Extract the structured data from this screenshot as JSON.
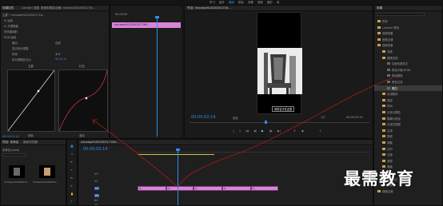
{
  "menubar": {
    "left_tabs": [
      "效果控件",
      "Lumetri 范围",
      "音频剪辑混合器: minzepl2020031716...",
      "minzepl2020031716..."
    ],
    "right_items": [
      "学习",
      "组件",
      "编辑",
      "颜色",
      "效果",
      "音频",
      "图形",
      "库"
    ]
  },
  "effect_controls": {
    "source": "主要 * minzepa%2020031716...",
    "clip_label": "minzepa%20200317160...",
    "timecode_start": "00:00:00",
    "rows": [
      {
        "label": "fx 运动"
      },
      {
        "label": "fx 不透明度"
      },
      {
        "label": "时间重映射"
      },
      {
        "label": "RGB 曲线"
      },
      {
        "label": "输出",
        "value": "合成"
      },
      {
        "label": "显示拆分视图"
      },
      {
        "label": "布局",
        "value": "水平"
      },
      {
        "label": "拆分视图百分比",
        "value": "50.00 %"
      }
    ],
    "curve_labels": {
      "master": "主要",
      "red": "红色",
      "green": "绿色",
      "blue": "蓝色"
    },
    "footer_time": "00:00:02:14",
    "colors": {
      "master_curve": "#e0e0e0",
      "red_curve": "#c23838",
      "clip_pink": "#d884d8"
    }
  },
  "program_monitor": {
    "title": "节目: minzepa%2020031716...",
    "timecode": "00:00:02:14",
    "fit_label": "适合",
    "ratio": "1/2",
    "duration": "00:00:03:20",
    "caption": "你的名字在这里"
  },
  "project_panel": {
    "title": "项目: 未命名",
    "tab2": "媒体浏览器",
    "file": "未命名.prproj",
    "items": [
      {
        "name": "minzepa%2020031...",
        "duration": "5:00"
      },
      {
        "name": "minzepa%2020031...",
        "duration": "5:00"
      }
    ]
  },
  "timeline": {
    "tab": "minzepa%20200317160...",
    "timecode": "00:00:02:14",
    "tracks": [
      "V3",
      "V2",
      "V1",
      "A1",
      "A2",
      "A3"
    ],
    "clip_labels": [
      "fx",
      "fx",
      "fx",
      "fx",
      "fx"
    ]
  },
  "effects_panel": {
    "title": "效果",
    "items": [
      {
        "label": "预设",
        "level": 0
      },
      {
        "label": "Lumetri 预设",
        "level": 0
      },
      {
        "label": "音频效果",
        "level": 0
      },
      {
        "label": "音频过渡",
        "level": 0
      },
      {
        "label": "视频效果",
        "level": 0
      },
      {
        "label": "变换",
        "level": 1
      },
      {
        "label": "图像控制",
        "level": 1
      },
      {
        "label": "灰度系数校正",
        "level": 2
      },
      {
        "label": "颜色平衡(RGB)",
        "level": 2
      },
      {
        "label": "颜色替换",
        "level": 2
      },
      {
        "label": "颜色过滤",
        "level": 2
      },
      {
        "label": "黑白",
        "level": 2,
        "selected": true
      },
      {
        "label": "实用程序",
        "level": 1
      },
      {
        "label": "扭曲",
        "level": 1
      },
      {
        "label": "时间",
        "level": 1
      },
      {
        "label": "杂色与颗粒",
        "level": 1
      },
      {
        "label": "模糊与锐化",
        "level": 1
      },
      {
        "label": "沉浸式视频",
        "level": 1
      },
      {
        "label": "生成",
        "level": 1
      },
      {
        "label": "视频",
        "level": 1
      },
      {
        "label": "调整",
        "level": 1
      },
      {
        "label": "过时",
        "level": 1
      },
      {
        "label": "过渡",
        "level": 1
      },
      {
        "label": "透视",
        "level": 1
      },
      {
        "label": "通道",
        "level": 1
      },
      {
        "label": "键控",
        "level": 1
      },
      {
        "label": "颜色校正",
        "level": 1
      },
      {
        "label": "风格化",
        "level": 1
      },
      {
        "label": "视频过渡",
        "level": 0
      }
    ]
  },
  "watermark": "最需教育"
}
